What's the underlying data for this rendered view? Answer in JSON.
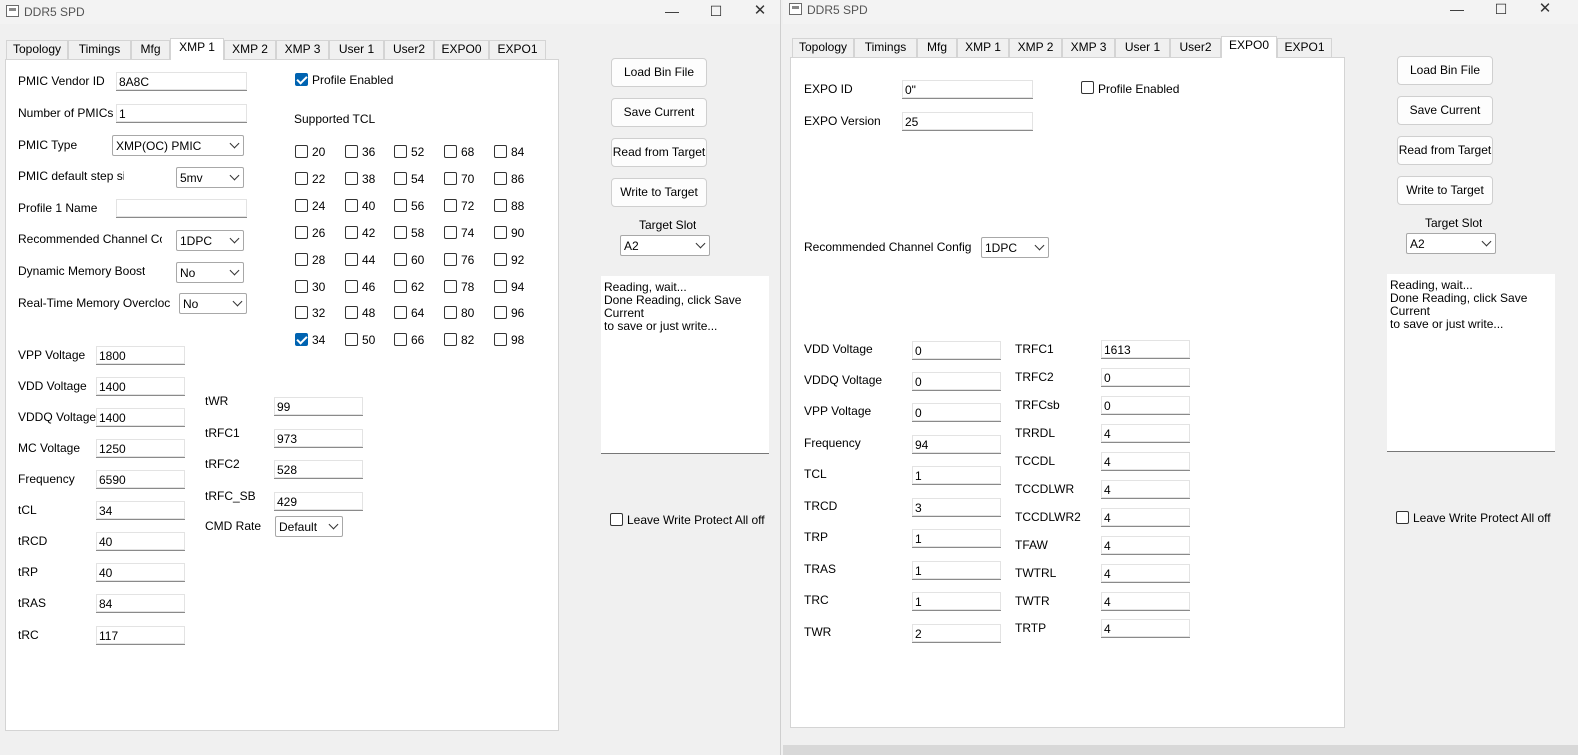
{
  "app_title": "DDR5 SPD",
  "controls": {
    "minimize": "—",
    "maximize": "☐",
    "close": "✕"
  },
  "tabs": [
    "Topology",
    "Timings",
    "Mfg",
    "XMP 1",
    "XMP 2",
    "XMP 3",
    "User 1",
    "User2",
    "EXPO0",
    "EXPO1"
  ],
  "buttons": {
    "load": "Load Bin File",
    "save": "Save Current",
    "read": "Read from Target",
    "write": "Write to Target"
  },
  "target_slot": {
    "label": "Target Slot",
    "value": "A2"
  },
  "log_text": "Reading, wait...\nDone Reading, click Save Current\nto save or just write...",
  "write_protect": {
    "label": "Leave Write Protect All off",
    "checked": false
  },
  "left": {
    "active_tab": "XMP 1",
    "pmic_vendor_id": {
      "label": "PMIC Vendor ID",
      "value": "8A8C"
    },
    "num_pmics": {
      "label": "Number of PMICs",
      "value": "1"
    },
    "pmic_type": {
      "label": "PMIC Type",
      "value": "XMP(OC) PMIC"
    },
    "pmic_step": {
      "label": "PMIC default step size",
      "value": "5mv"
    },
    "profile_name": {
      "label": "Profile 1 Name",
      "value": ""
    },
    "channel_config": {
      "label": "Recommended Channel Config",
      "value": "1DPC"
    },
    "dyn_boost": {
      "label": "Dynamic Memory Boost",
      "value": "No"
    },
    "rt_oc": {
      "label": "Real-Time Memory Overclocking",
      "value": "No"
    },
    "profile_enabled": {
      "label": "Profile Enabled",
      "checked": true
    },
    "supported_tcl_label": "Supported TCL",
    "tcl_columns": [
      [
        "20",
        "22",
        "24",
        "26",
        "28",
        "30",
        "32",
        "34"
      ],
      [
        "36",
        "38",
        "40",
        "42",
        "44",
        "46",
        "48",
        "50"
      ],
      [
        "52",
        "54",
        "56",
        "58",
        "60",
        "62",
        "64",
        "66"
      ],
      [
        "68",
        "70",
        "72",
        "74",
        "76",
        "78",
        "80",
        "82"
      ],
      [
        "84",
        "86",
        "88",
        "90",
        "92",
        "94",
        "96",
        "98"
      ]
    ],
    "tcl_checked": [
      "34"
    ],
    "fields": [
      {
        "label": "VPP Voltage",
        "value": "1800"
      },
      {
        "label": "VDD Voltage",
        "value": "1400"
      },
      {
        "label": "VDDQ Voltage",
        "value": "1400"
      },
      {
        "label": "MC Voltage",
        "value": "1250"
      },
      {
        "label": "Frequency",
        "value": "6590"
      },
      {
        "label": "tCL",
        "value": "34"
      },
      {
        "label": "tRCD",
        "value": "40"
      },
      {
        "label": "tRP",
        "value": "40"
      },
      {
        "label": "tRAS",
        "value": "84"
      },
      {
        "label": "tRC",
        "value": "117"
      }
    ],
    "fields2": [
      {
        "label": "tWR",
        "value": "99"
      },
      {
        "label": "tRFC1",
        "value": "973"
      },
      {
        "label": "tRFC2",
        "value": "528"
      },
      {
        "label": "tRFC_SB",
        "value": "429"
      }
    ],
    "cmd_rate": {
      "label": "CMD Rate",
      "value": "Default"
    }
  },
  "right": {
    "active_tab": "EXPO0",
    "expo_id": {
      "label": "EXPO ID",
      "value": "0\""
    },
    "expo_version": {
      "label": "EXPO Version",
      "value": "25"
    },
    "profile_enabled": {
      "label": "Profile Enabled",
      "checked": false
    },
    "channel_config": {
      "label": "Recommended Channel Config",
      "value": "1DPC"
    },
    "fields": [
      {
        "label": "VDD Voltage",
        "value": "0"
      },
      {
        "label": "VDDQ Voltage",
        "value": "0"
      },
      {
        "label": "VPP Voltage",
        "value": "0"
      },
      {
        "label": "Frequency",
        "value": "94"
      },
      {
        "label": "TCL",
        "value": "1"
      },
      {
        "label": "TRCD",
        "value": "3"
      },
      {
        "label": "TRP",
        "value": "1"
      },
      {
        "label": "TRAS",
        "value": "1"
      },
      {
        "label": "TRC",
        "value": "1"
      },
      {
        "label": "TWR",
        "value": "2"
      }
    ],
    "fields2": [
      {
        "label": "TRFC1",
        "value": "1613"
      },
      {
        "label": "TRFC2",
        "value": "0"
      },
      {
        "label": "TRFCsb",
        "value": "0"
      },
      {
        "label": "TRRDL",
        "value": "4"
      },
      {
        "label": "TCCDL",
        "value": "4"
      },
      {
        "label": "TCCDLWR",
        "value": "4"
      },
      {
        "label": "TCCDLWR2",
        "value": "4"
      },
      {
        "label": "TFAW",
        "value": "4"
      },
      {
        "label": "TWTRL",
        "value": "4"
      },
      {
        "label": "TWTR",
        "value": "4"
      },
      {
        "label": "TRTP",
        "value": "4"
      }
    ]
  }
}
